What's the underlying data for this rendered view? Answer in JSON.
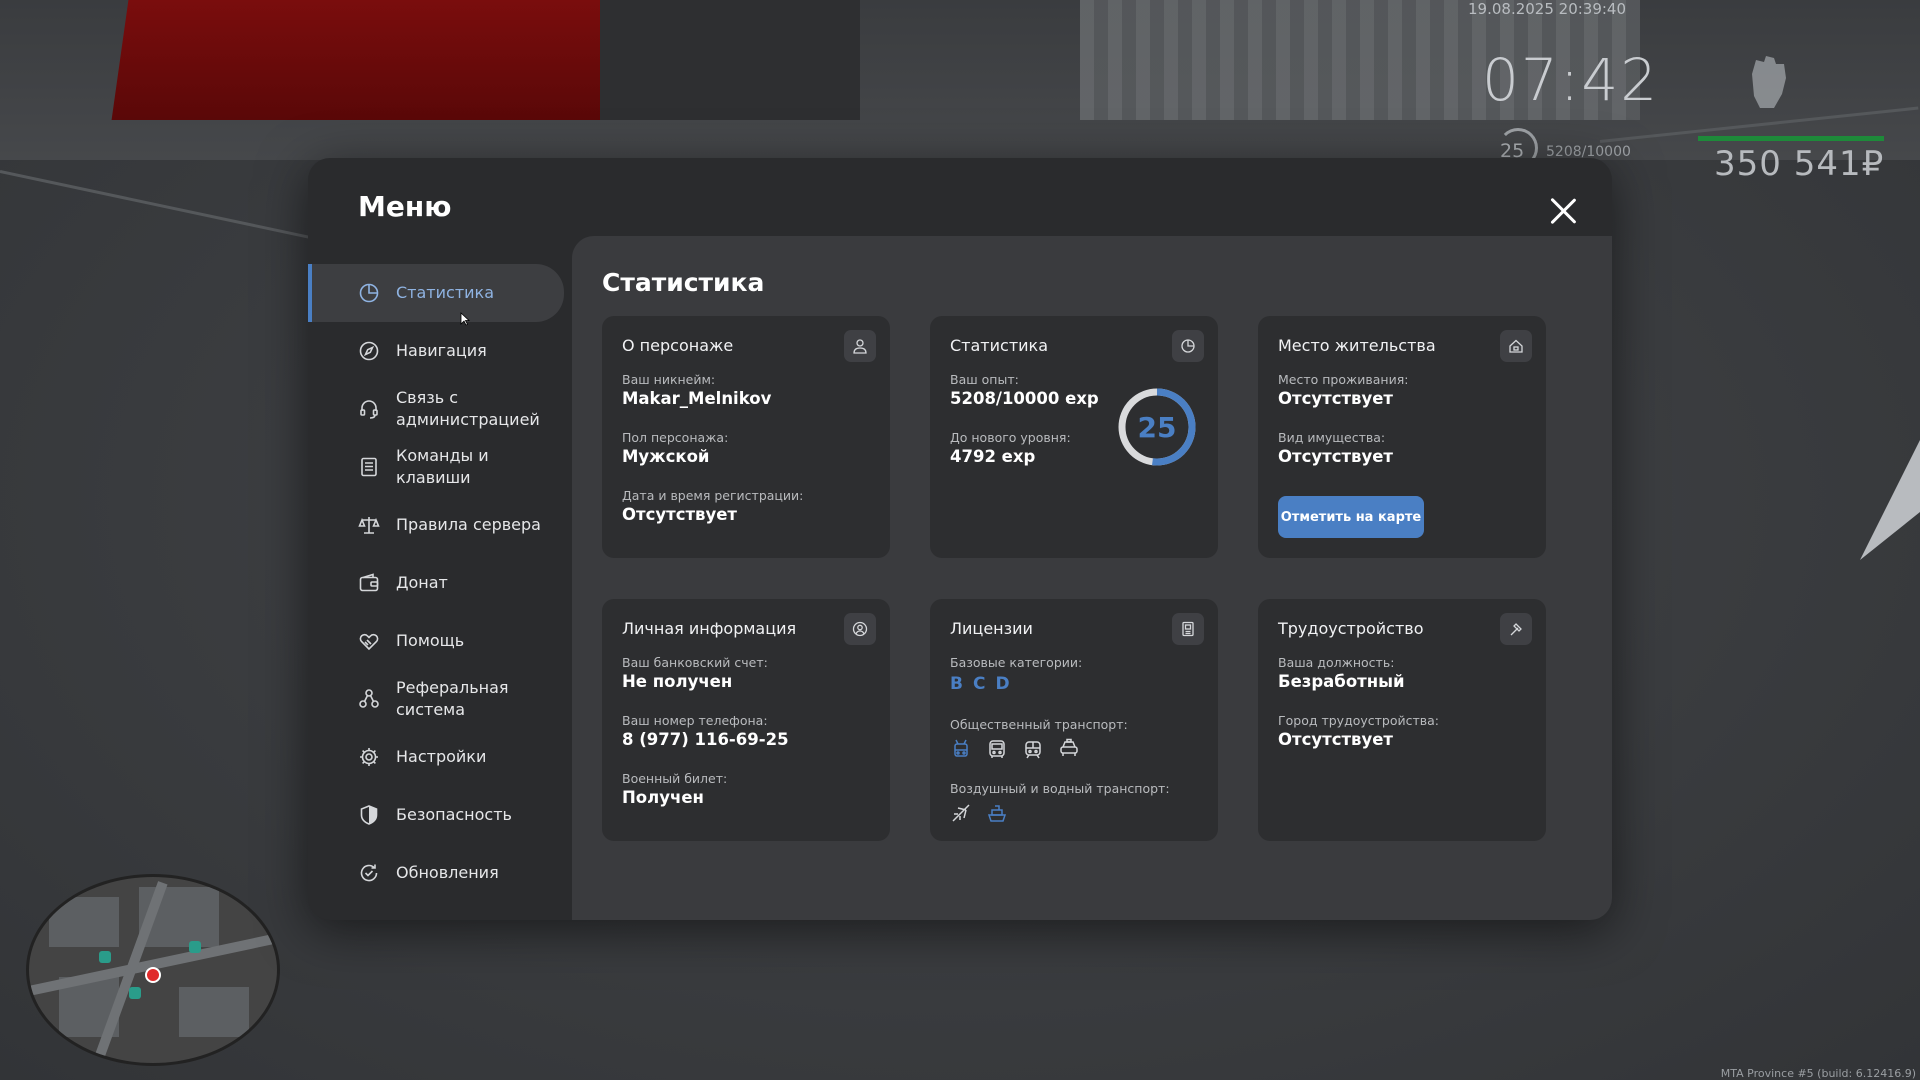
{
  "hud": {
    "datetime": "19.08.2025 20:39:40",
    "clock": "07:42",
    "level": "25",
    "exp": "5208/10000",
    "money": "350 541₽"
  },
  "build_info": "MTA Province #5 (build: 6.12416.9)",
  "menu": {
    "title": "Меню",
    "sidebar": [
      {
        "label": "Статистика",
        "icon": "pie-chart-icon",
        "active": true
      },
      {
        "label": "Навигация",
        "icon": "compass-icon"
      },
      {
        "label": "Связь с\nадминистрацией",
        "icon": "headset-icon"
      },
      {
        "label": "Команды и\nклавиши",
        "icon": "document-list-icon"
      },
      {
        "label": "Правила сервера",
        "icon": "scales-icon"
      },
      {
        "label": "Донат",
        "icon": "wallet-icon"
      },
      {
        "label": "Помощь",
        "icon": "handshake-heart-icon"
      },
      {
        "label": "Реферальная\nсистема",
        "icon": "network-users-icon"
      },
      {
        "label": "Настройки",
        "icon": "gear-icon"
      },
      {
        "label": "Безопасность",
        "icon": "shield-icon"
      },
      {
        "label": "Обновления",
        "icon": "refresh-check-icon"
      }
    ]
  },
  "content": {
    "title": "Статистика",
    "about": {
      "title": "О персонаже",
      "icon": "user-icon",
      "nickname_label": "Ваш никнейм:",
      "nickname": "Makar_Melnikov",
      "gender_label": "Пол персонажа:",
      "gender": "Мужской",
      "reg_label": "Дата и время регистрации:",
      "reg": "Отсутствует"
    },
    "stats": {
      "title": "Статистика",
      "icon": "pie-chart-icon",
      "exp_label": "Ваш опыт:",
      "exp": "5208/10000 exp",
      "next_label": "До нового уровня:",
      "next": "4792 exp",
      "level": "25",
      "progress": 0.52
    },
    "residence": {
      "title": "Место жительства",
      "icon": "house-icon",
      "place_label": "Место проживания:",
      "place": "Отсутствует",
      "prop_label": "Вид имущества:",
      "prop": "Отсутствует",
      "button": "Отметить на карте"
    },
    "personal": {
      "title": "Личная информация",
      "icon": "user-circle-icon",
      "bank_label": "Ваш банковский счет:",
      "bank": "Не получен",
      "phone_label": "Ваш номер телефона:",
      "phone": "8 (977) 116-69-25",
      "military_label": "Военный билет:",
      "military": "Получен"
    },
    "licenses": {
      "title": "Лицензии",
      "icon": "id-card-icon",
      "base_label": "Базовые категории:",
      "base": [
        "B",
        "C",
        "D"
      ],
      "public_label": "Общественный транспорт:",
      "air_label": "Воздушный и водный транспорт:"
    },
    "job": {
      "title": "Трудоустройство",
      "icon": "hammer-icon",
      "position_label": "Ваша должность:",
      "position": "Безработный",
      "city_label": "Город трудоустройства:",
      "city": "Отсутствует"
    }
  },
  "colors": {
    "accent": "#4a7fc4",
    "modal_bg": "#2a2b2d",
    "card_bg": "#2d2e30",
    "content_bg": "#3a3b3e"
  }
}
